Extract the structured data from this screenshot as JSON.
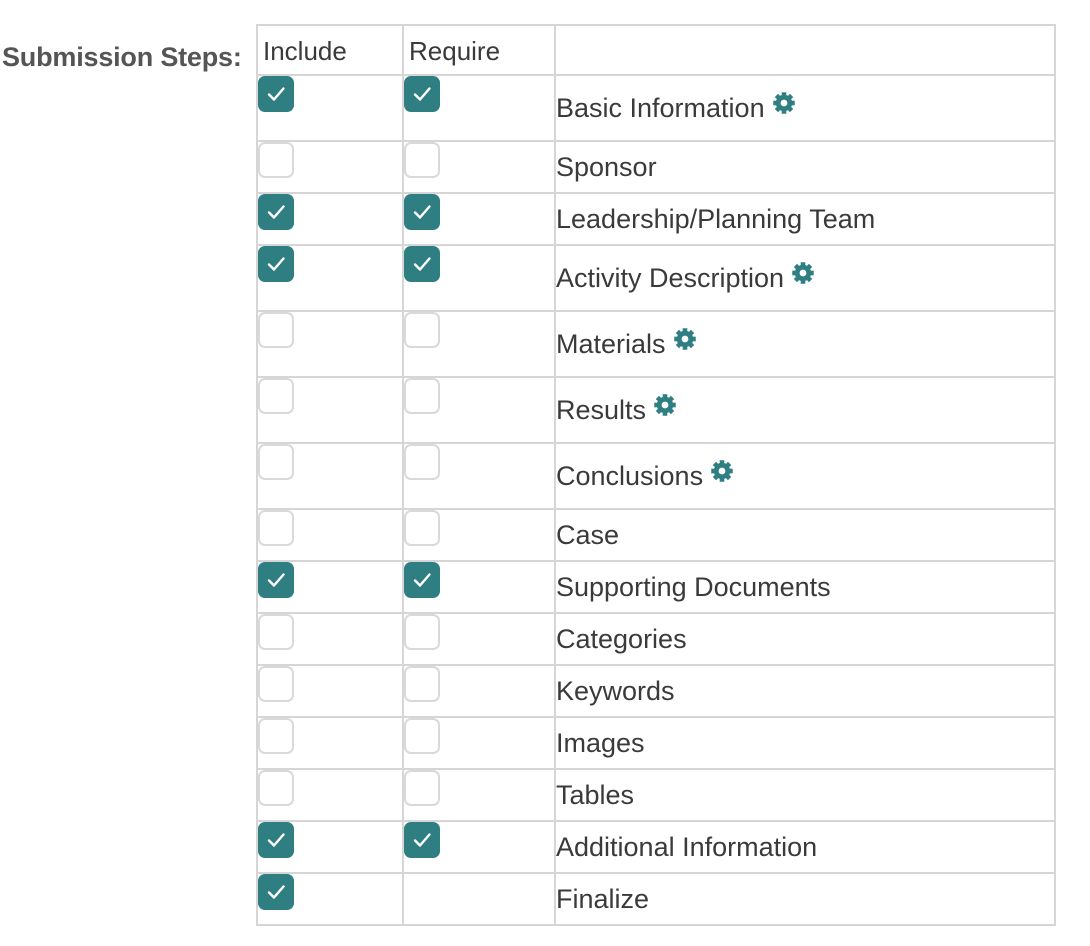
{
  "field_label": "Submission Steps:",
  "columns": {
    "include": "Include",
    "require": "Require",
    "name": ""
  },
  "accent_color": "#2f7f82",
  "rows": [
    {
      "name": "Basic Information",
      "include": true,
      "require": true,
      "settings": true,
      "icon": "gear-icon"
    },
    {
      "name": "Sponsor",
      "include": false,
      "require": false,
      "settings": false
    },
    {
      "name": "Leadership/Planning Team",
      "include": true,
      "require": true,
      "settings": false
    },
    {
      "name": "Activity Description",
      "include": true,
      "require": true,
      "settings": true,
      "icon": "gear-icon"
    },
    {
      "name": "Materials",
      "include": false,
      "require": false,
      "settings": true,
      "icon": "gear-icon"
    },
    {
      "name": "Results",
      "include": false,
      "require": false,
      "settings": true,
      "icon": "gear-icon"
    },
    {
      "name": "Conclusions",
      "include": false,
      "require": false,
      "settings": true,
      "icon": "gear-icon"
    },
    {
      "name": "Case",
      "include": false,
      "require": false,
      "settings": false
    },
    {
      "name": "Supporting Documents",
      "include": true,
      "require": true,
      "settings": false
    },
    {
      "name": "Categories",
      "include": false,
      "require": false,
      "settings": false
    },
    {
      "name": "Keywords",
      "include": false,
      "require": false,
      "settings": false
    },
    {
      "name": "Images",
      "include": false,
      "require": false,
      "settings": false
    },
    {
      "name": "Tables",
      "include": false,
      "require": false,
      "settings": false
    },
    {
      "name": "Additional Information",
      "include": true,
      "require": true,
      "settings": false
    },
    {
      "name": "Finalize",
      "include": true,
      "require": null,
      "settings": false
    }
  ]
}
